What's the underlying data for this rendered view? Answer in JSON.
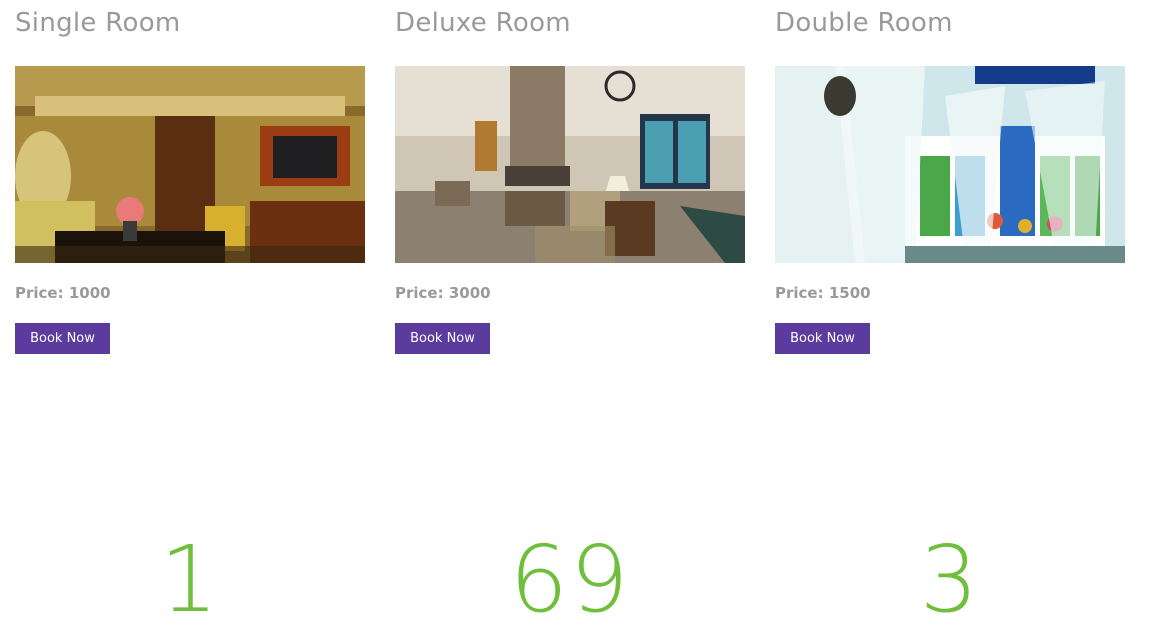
{
  "rooms": [
    {
      "title": "Single Room",
      "price": "Price: 1000",
      "button": "Book Now",
      "image": "single-room-photo"
    },
    {
      "title": "Deluxe Room",
      "price": "Price: 3000",
      "button": "Book Now",
      "image": "deluxe-room-photo"
    },
    {
      "title": "Double Room",
      "price": "Price: 1500",
      "button": "Book Now",
      "image": "double-room-photo"
    }
  ],
  "stats": [
    "1",
    "69",
    "3"
  ],
  "colors": {
    "heading": "#9a9a9a",
    "button": "#5b3b9e",
    "stat": "#6fbf3c"
  }
}
